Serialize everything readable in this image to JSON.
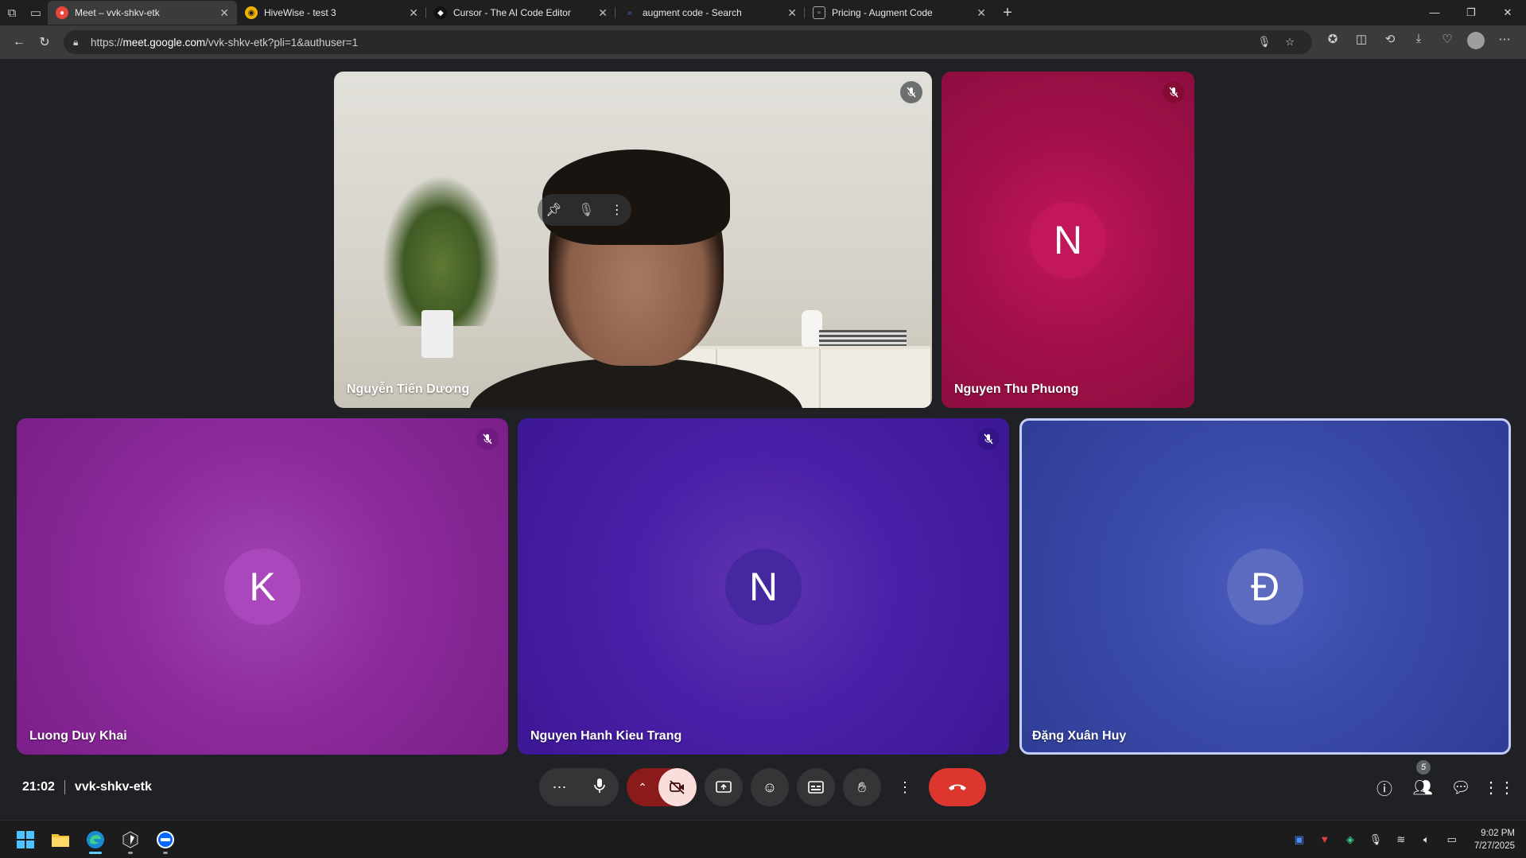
{
  "browser": {
    "tabs": [
      {
        "title": "Meet – vvk-shkv-etk",
        "active": true,
        "icon": "meet-icon"
      },
      {
        "title": "HiveWise - test 3",
        "active": false,
        "icon": "hivewise-icon"
      },
      {
        "title": "Cursor - The AI Code Editor",
        "active": false,
        "icon": "cursor-icon"
      },
      {
        "title": "augment code - Search",
        "active": false,
        "icon": "search-icon"
      },
      {
        "title": "Pricing - Augment Code",
        "active": false,
        "icon": "page-icon"
      }
    ],
    "url_prefix": "https://",
    "url_host": "meet.google.com",
    "url_path": "/vvk-shkv-etk?pli=1&authuser=1"
  },
  "meet": {
    "participants": [
      {
        "name": "Nguyễn Tiến Dương",
        "video": true,
        "muted": true
      },
      {
        "name": "Nguyen Thu Phuong",
        "initial": "N",
        "muted": true,
        "bg": "#a5104a",
        "avatar_color": "#c2185b"
      },
      {
        "name": "Luong Duy Khai",
        "initial": "K",
        "muted": true,
        "bg": "#8e2a9c",
        "avatar_color": "#ab47bc"
      },
      {
        "name": "Nguyen Hanh Kieu Trang",
        "initial": "N",
        "muted": true,
        "bg": "#4a1fa8",
        "avatar_color": "#4527a0"
      },
      {
        "name": "Đặng Xuân Huy",
        "initial": "Đ",
        "muted": false,
        "speaking": true,
        "bg": "#3a4aa8",
        "avatar_color": "#5c6bc0"
      }
    ],
    "time": "21:02",
    "meeting_code": "vvk-shkv-etk",
    "people_count": "5"
  },
  "taskbar": {
    "time": "9:02 PM",
    "date": "7/27/2025"
  }
}
